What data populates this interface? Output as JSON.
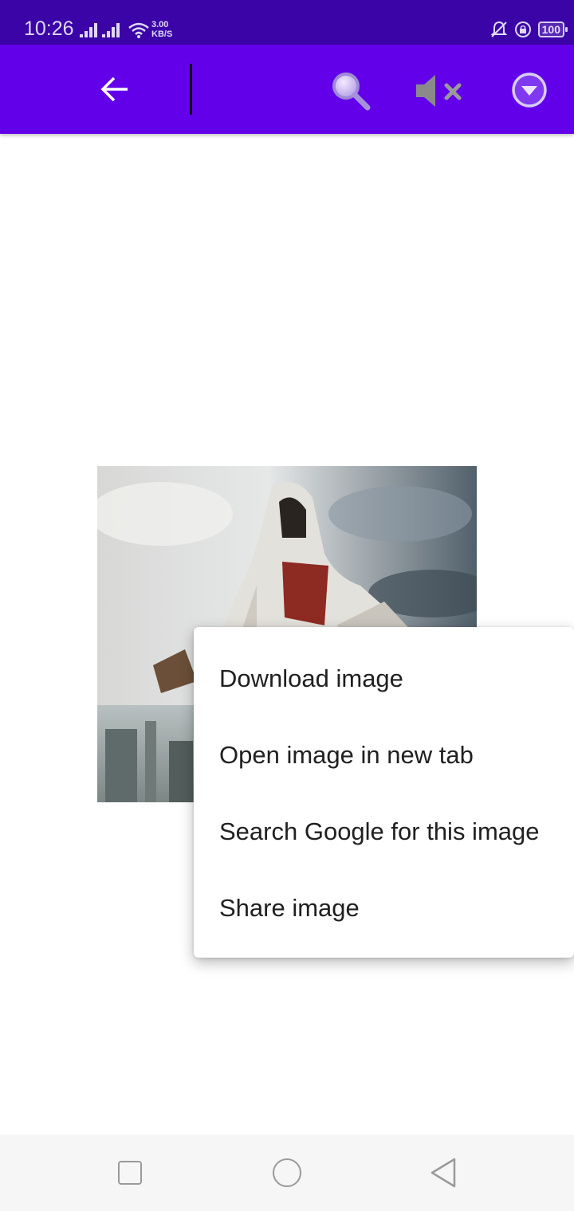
{
  "status_bar": {
    "time": "10:26",
    "net_speed_value": "3.00",
    "net_speed_unit": "KB/S",
    "battery": "100"
  },
  "toolbar": {
    "back_icon": "arrow-left-icon",
    "search_icon": "search-icon",
    "mute_icon": "volume-mute-icon",
    "dropdown_icon": "chevron-down-circle-icon",
    "background_color": "#6200ea"
  },
  "content": {
    "image_icon": "hooded-assassin-image"
  },
  "context_menu": {
    "items": [
      {
        "label": "Download image"
      },
      {
        "label": "Open image in new tab"
      },
      {
        "label": "Search Google for this image"
      },
      {
        "label": "Share image"
      }
    ]
  },
  "nav_bar": {
    "recent_icon": "square-icon",
    "home_icon": "circle-icon",
    "back_icon": "triangle-back-icon"
  }
}
